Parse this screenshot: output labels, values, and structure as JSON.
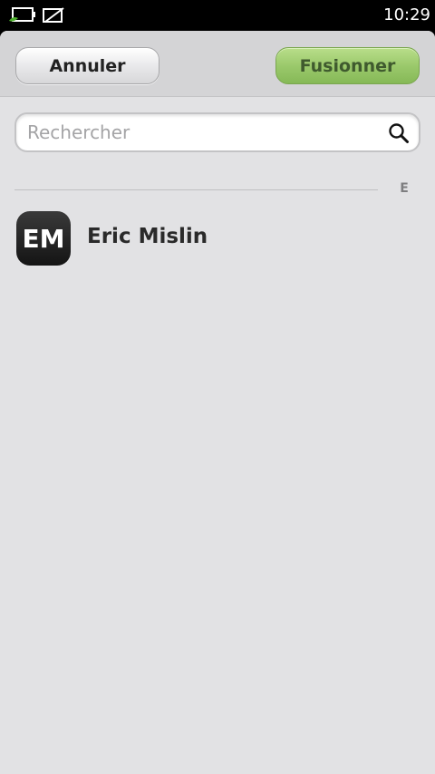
{
  "status_bar": {
    "time": "10:29",
    "icons": [
      "battery-charging-icon",
      "no-sim-icon"
    ]
  },
  "toolbar": {
    "cancel_label": "Annuler",
    "merge_label": "Fusionner"
  },
  "search": {
    "placeholder": "Rechercher",
    "value": ""
  },
  "contacts": {
    "section_letter": "E",
    "items": [
      {
        "initials": "EM",
        "name": "Eric Mislin"
      }
    ]
  },
  "colors": {
    "accent_green": "#98c769",
    "background": "#e2e2e4"
  }
}
